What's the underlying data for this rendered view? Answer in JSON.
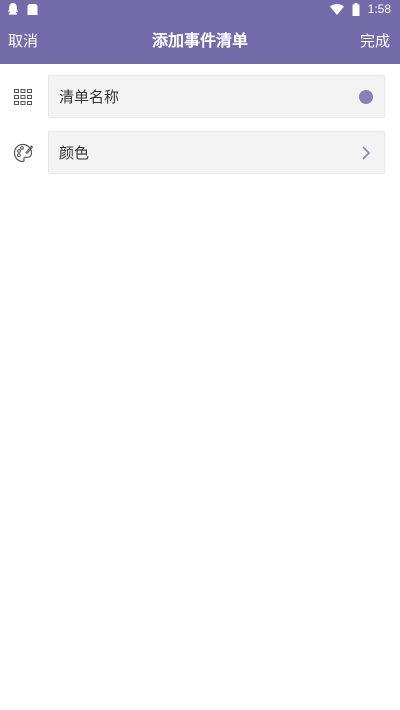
{
  "status_bar": {
    "time": "1:58",
    "icons": [
      "qq-icon",
      "notification-icon",
      "wifi-icon",
      "battery-icon"
    ]
  },
  "app_bar": {
    "cancel_label": "取消",
    "title": "添加事件清单",
    "done_label": "完成"
  },
  "form": {
    "name_field": {
      "placeholder": "清单名称",
      "icon": "grid-icon",
      "color_swatch": "#8a80b8"
    },
    "color_field": {
      "label": "颜色",
      "icon": "palette-icon",
      "chevron": "chevron-right-icon"
    }
  },
  "colors": {
    "primary": "#736aa9",
    "field_bg": "#f3f3f3",
    "swatch": "#8a80b8"
  }
}
